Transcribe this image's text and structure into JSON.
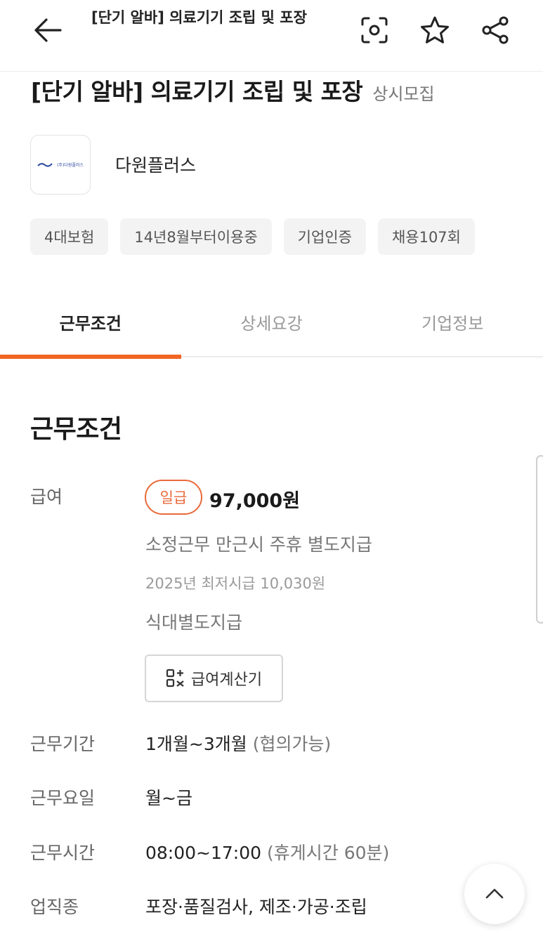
{
  "appbar": {
    "title": "[단기 알바] 의료기기 조립 및 포장"
  },
  "headline": {
    "title": "[단기 알바] 의료기기 조립 및 포장",
    "badge": "상시모집"
  },
  "company": {
    "name": "다원플러스",
    "logo_text": "(주)다원플러스"
  },
  "chips": [
    "4대보험",
    "14년8월부터이용중",
    "기업인증",
    "채용107회"
  ],
  "tabs": [
    {
      "label": "근무조건",
      "active": true
    },
    {
      "label": "상세요강",
      "active": false
    },
    {
      "label": "기업정보",
      "active": false
    }
  ],
  "section": {
    "title": "근무조건"
  },
  "pay": {
    "label": "급여",
    "type": "일급",
    "amount": "97,000원",
    "note1": "소정근무 만근시 주휴 별도지급",
    "min_wage": "2025년 최저시급 10,030원",
    "note2": "식대별도지급",
    "calc_button": "급여계산기"
  },
  "period": {
    "label": "근무기간",
    "value": "1개월~3개월",
    "extra": "(협의가능)"
  },
  "days": {
    "label": "근무요일",
    "value": "월~금"
  },
  "hours": {
    "label": "근무시간",
    "value": "08:00~17:00",
    "extra": "(휴게시간 60분)"
  },
  "job": {
    "label": "업직종",
    "value": "포장·품질검사, 제조·가공·조립"
  },
  "colors": {
    "accent": "#f26522",
    "pay_badge": "#e86a3a"
  }
}
